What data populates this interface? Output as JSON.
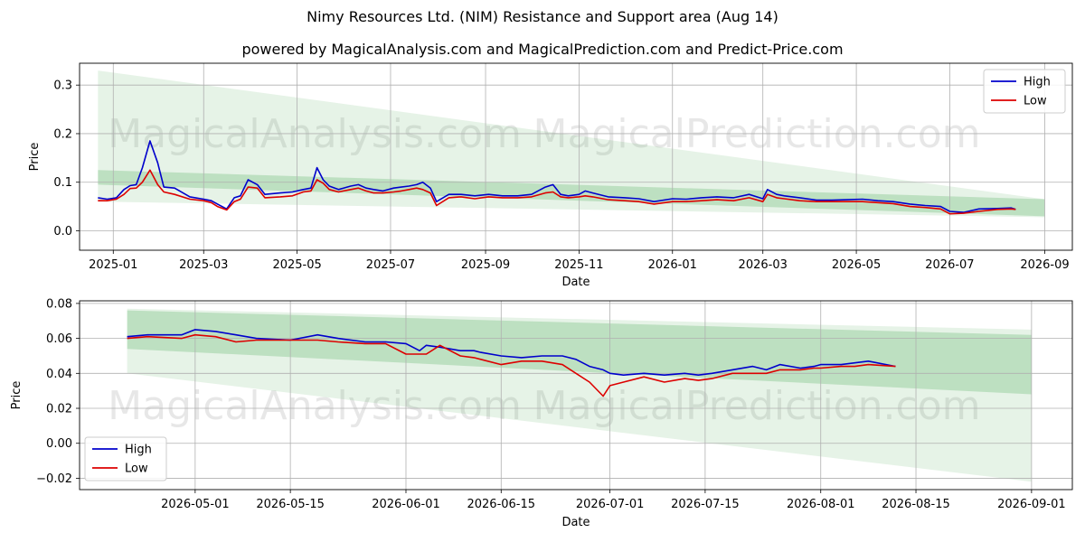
{
  "title": "Nimy Resources Ltd. (NIM) Resistance and Support area (Aug 14)",
  "subtitle": "powered by MagicalAnalysis.com and MagicalPrediction.com and Predict-Price.com",
  "watermarks": [
    "MagicalAnalysis.com",
    "MagicalPrediction.com"
  ],
  "colors": {
    "high": "#0000cc",
    "low": "#dd0000",
    "band": "#2e9e3a"
  },
  "chart_data": [
    {
      "type": "line",
      "xlabel": "Date",
      "ylabel": "Price",
      "xlim": [
        "2024-12-10",
        "2026-09-19"
      ],
      "ylim": [
        -0.04,
        0.345
      ],
      "xticks": [
        {
          "date": "2025-01-01",
          "label": "2025-01"
        },
        {
          "date": "2025-03-01",
          "label": "2025-03"
        },
        {
          "date": "2025-05-01",
          "label": "2025-05"
        },
        {
          "date": "2025-07-01",
          "label": "2025-07"
        },
        {
          "date": "2025-09-01",
          "label": "2025-09"
        },
        {
          "date": "2025-11-01",
          "label": "2025-11"
        },
        {
          "date": "2026-01-01",
          "label": "2026-01"
        },
        {
          "date": "2026-03-01",
          "label": "2026-03"
        },
        {
          "date": "2026-05-01",
          "label": "2026-05"
        },
        {
          "date": "2026-07-01",
          "label": "2026-07"
        },
        {
          "date": "2026-09-01",
          "label": "2026-09"
        }
      ],
      "yticks": [
        0.0,
        0.1,
        0.2,
        0.3
      ],
      "ytick_labels": [
        "0.0",
        "0.1",
        "0.2",
        "0.3"
      ],
      "grid": true,
      "legend": "top-right",
      "bands": [
        {
          "x": [
            "2024-12-22",
            "2026-09-01"
          ],
          "upper": [
            0.33,
            0.065
          ],
          "lower": [
            0.06,
            0.028
          ],
          "alpha": 0.12
        },
        {
          "x": [
            "2024-12-22",
            "2026-09-01"
          ],
          "upper": [
            0.125,
            0.065
          ],
          "lower": [
            0.095,
            0.03
          ],
          "alpha": 0.22
        }
      ],
      "series": [
        {
          "name": "High",
          "x": [
            "2024-12-22",
            "2024-12-28",
            "2025-01-03",
            "2025-01-08",
            "2025-01-12",
            "2025-01-16",
            "2025-01-20",
            "2025-01-25",
            "2025-01-30",
            "2025-02-03",
            "2025-02-10",
            "2025-02-20",
            "2025-03-01",
            "2025-03-06",
            "2025-03-10",
            "2025-03-16",
            "2025-03-21",
            "2025-03-25",
            "2025-03-30",
            "2025-04-05",
            "2025-04-10",
            "2025-04-20",
            "2025-04-28",
            "2025-05-05",
            "2025-05-10",
            "2025-05-14",
            "2025-05-18",
            "2025-05-22",
            "2025-05-28",
            "2025-06-05",
            "2025-06-10",
            "2025-06-15",
            "2025-06-20",
            "2025-06-26",
            "2025-07-03",
            "2025-07-08",
            "2025-07-13",
            "2025-07-18",
            "2025-07-22",
            "2025-07-27",
            "2025-07-31",
            "2025-08-08",
            "2025-08-16",
            "2025-08-25",
            "2025-09-03",
            "2025-09-12",
            "2025-09-22",
            "2025-10-01",
            "2025-10-10",
            "2025-10-15",
            "2025-10-20",
            "2025-10-25",
            "2025-11-01",
            "2025-11-05",
            "2025-11-10",
            "2025-11-20",
            "2025-12-01",
            "2025-12-10",
            "2025-12-20",
            "2026-01-01",
            "2026-01-10",
            "2026-01-20",
            "2026-01-30",
            "2026-02-10",
            "2026-02-20",
            "2026-03-01",
            "2026-03-04",
            "2026-03-10",
            "2026-03-15",
            "2026-03-25",
            "2026-04-05",
            "2026-04-15",
            "2026-04-25",
            "2026-05-05",
            "2026-05-15",
            "2026-05-25",
            "2026-06-05",
            "2026-06-15",
            "2026-06-25",
            "2026-07-01",
            "2026-07-10",
            "2026-07-20",
            "2026-08-01",
            "2026-08-10",
            "2026-08-13"
          ],
          "values": [
            0.068,
            0.065,
            0.068,
            0.085,
            0.093,
            0.095,
            0.13,
            0.185,
            0.14,
            0.09,
            0.088,
            0.07,
            0.065,
            0.062,
            0.055,
            0.045,
            0.068,
            0.072,
            0.105,
            0.095,
            0.075,
            0.078,
            0.08,
            0.085,
            0.088,
            0.13,
            0.105,
            0.092,
            0.085,
            0.092,
            0.095,
            0.088,
            0.085,
            0.082,
            0.088,
            0.09,
            0.092,
            0.095,
            0.1,
            0.088,
            0.06,
            0.075,
            0.075,
            0.072,
            0.075,
            0.072,
            0.072,
            0.075,
            0.09,
            0.095,
            0.075,
            0.072,
            0.075,
            0.082,
            0.078,
            0.07,
            0.068,
            0.066,
            0.06,
            0.066,
            0.065,
            0.068,
            0.07,
            0.068,
            0.075,
            0.066,
            0.085,
            0.075,
            0.072,
            0.068,
            0.063,
            0.063,
            0.064,
            0.065,
            0.062,
            0.06,
            0.055,
            0.052,
            0.05,
            0.04,
            0.038,
            0.045,
            0.046,
            0.047,
            0.044
          ]
        },
        {
          "name": "Low",
          "x": [
            "2024-12-22",
            "2024-12-28",
            "2025-01-03",
            "2025-01-08",
            "2025-01-12",
            "2025-01-16",
            "2025-01-20",
            "2025-01-25",
            "2025-01-30",
            "2025-02-03",
            "2025-02-10",
            "2025-02-20",
            "2025-03-01",
            "2025-03-06",
            "2025-03-10",
            "2025-03-16",
            "2025-03-21",
            "2025-03-25",
            "2025-03-30",
            "2025-04-05",
            "2025-04-10",
            "2025-04-20",
            "2025-04-28",
            "2025-05-05",
            "2025-05-10",
            "2025-05-14",
            "2025-05-18",
            "2025-05-22",
            "2025-05-28",
            "2025-06-05",
            "2025-06-10",
            "2025-06-15",
            "2025-06-20",
            "2025-06-26",
            "2025-07-03",
            "2025-07-08",
            "2025-07-13",
            "2025-07-18",
            "2025-07-22",
            "2025-07-27",
            "2025-07-31",
            "2025-08-08",
            "2025-08-16",
            "2025-08-25",
            "2025-09-03",
            "2025-09-12",
            "2025-09-22",
            "2025-10-01",
            "2025-10-10",
            "2025-10-15",
            "2025-10-20",
            "2025-10-25",
            "2025-11-01",
            "2025-11-05",
            "2025-11-10",
            "2025-11-20",
            "2025-12-01",
            "2025-12-10",
            "2025-12-20",
            "2026-01-01",
            "2026-01-10",
            "2026-01-20",
            "2026-01-30",
            "2026-02-10",
            "2026-02-20",
            "2026-03-01",
            "2026-03-04",
            "2026-03-10",
            "2026-03-15",
            "2026-03-25",
            "2026-04-05",
            "2026-04-15",
            "2026-04-25",
            "2026-05-05",
            "2026-05-15",
            "2026-05-25",
            "2026-06-05",
            "2026-06-15",
            "2026-06-25",
            "2026-07-01",
            "2026-07-10",
            "2026-07-20",
            "2026-08-01",
            "2026-08-10",
            "2026-08-13"
          ],
          "values": [
            0.062,
            0.062,
            0.065,
            0.075,
            0.087,
            0.088,
            0.1,
            0.125,
            0.095,
            0.08,
            0.075,
            0.065,
            0.062,
            0.058,
            0.05,
            0.043,
            0.06,
            0.065,
            0.09,
            0.088,
            0.068,
            0.07,
            0.072,
            0.08,
            0.082,
            0.105,
            0.098,
            0.085,
            0.08,
            0.085,
            0.088,
            0.082,
            0.078,
            0.078,
            0.08,
            0.082,
            0.085,
            0.088,
            0.085,
            0.078,
            0.052,
            0.068,
            0.07,
            0.066,
            0.07,
            0.068,
            0.068,
            0.07,
            0.078,
            0.08,
            0.07,
            0.068,
            0.07,
            0.072,
            0.07,
            0.064,
            0.062,
            0.06,
            0.055,
            0.06,
            0.06,
            0.062,
            0.064,
            0.062,
            0.068,
            0.06,
            0.075,
            0.068,
            0.066,
            0.062,
            0.06,
            0.06,
            0.06,
            0.06,
            0.058,
            0.056,
            0.05,
            0.048,
            0.045,
            0.035,
            0.036,
            0.04,
            0.044,
            0.045,
            0.044
          ]
        }
      ]
    },
    {
      "type": "line",
      "xlabel": "Date",
      "ylabel": "Price",
      "xlim": [
        "2026-04-14",
        "2026-09-07"
      ],
      "ylim": [
        -0.0265,
        0.0815
      ],
      "xticks": [
        {
          "date": "2026-05-01",
          "label": "2026-05-01"
        },
        {
          "date": "2026-05-15",
          "label": "2026-05-15"
        },
        {
          "date": "2026-06-01",
          "label": "2026-06-01"
        },
        {
          "date": "2026-06-15",
          "label": "2026-06-15"
        },
        {
          "date": "2026-07-01",
          "label": "2026-07-01"
        },
        {
          "date": "2026-07-15",
          "label": "2026-07-15"
        },
        {
          "date": "2026-08-01",
          "label": "2026-08-01"
        },
        {
          "date": "2026-08-15",
          "label": "2026-08-15"
        },
        {
          "date": "2026-09-01",
          "label": "2026-09-01"
        }
      ],
      "yticks": [
        -0.02,
        0.0,
        0.02,
        0.04,
        0.06,
        0.08
      ],
      "ytick_labels": [
        "−0.02",
        "0.00",
        "0.02",
        "0.04",
        "0.06",
        "0.08"
      ],
      "grid": true,
      "legend": "bottom-left",
      "bands": [
        {
          "x": [
            "2026-04-21",
            "2026-09-01"
          ],
          "upper": [
            0.077,
            0.065
          ],
          "lower": [
            0.04,
            -0.022
          ],
          "alpha": 0.12
        },
        {
          "x": [
            "2026-04-21",
            "2026-09-01"
          ],
          "upper": [
            0.076,
            0.062
          ],
          "lower": [
            0.054,
            0.028
          ],
          "alpha": 0.22
        }
      ],
      "series": [
        {
          "name": "High",
          "x": [
            "2026-04-21",
            "2026-04-24",
            "2026-04-29",
            "2026-05-01",
            "2026-05-04",
            "2026-05-07",
            "2026-05-10",
            "2026-05-15",
            "2026-05-19",
            "2026-05-22",
            "2026-05-26",
            "2026-05-29",
            "2026-06-01",
            "2026-06-03",
            "2026-06-04",
            "2026-06-06",
            "2026-06-09",
            "2026-06-11",
            "2026-06-12",
            "2026-06-15",
            "2026-06-18",
            "2026-06-21",
            "2026-06-24",
            "2026-06-26",
            "2026-06-28",
            "2026-06-30",
            "2026-07-01",
            "2026-07-03",
            "2026-07-06",
            "2026-07-09",
            "2026-07-12",
            "2026-07-14",
            "2026-07-16",
            "2026-07-19",
            "2026-07-22",
            "2026-07-24",
            "2026-07-26",
            "2026-07-29",
            "2026-07-31",
            "2026-08-01",
            "2026-08-04",
            "2026-08-06",
            "2026-08-08",
            "2026-08-12"
          ],
          "values": [
            0.061,
            0.062,
            0.062,
            0.065,
            0.064,
            0.062,
            0.06,
            0.059,
            0.062,
            0.06,
            0.058,
            0.058,
            0.057,
            0.053,
            0.056,
            0.055,
            0.053,
            0.053,
            0.052,
            0.05,
            0.049,
            0.05,
            0.05,
            0.048,
            0.044,
            0.042,
            0.04,
            0.039,
            0.04,
            0.039,
            0.04,
            0.039,
            0.04,
            0.042,
            0.044,
            0.042,
            0.045,
            0.043,
            0.044,
            0.045,
            0.045,
            0.046,
            0.047,
            0.044
          ]
        },
        {
          "name": "Low",
          "x": [
            "2026-04-21",
            "2026-04-24",
            "2026-04-29",
            "2026-05-01",
            "2026-05-04",
            "2026-05-07",
            "2026-05-10",
            "2026-05-15",
            "2026-05-19",
            "2026-05-22",
            "2026-05-26",
            "2026-05-29",
            "2026-06-01",
            "2026-06-03",
            "2026-06-04",
            "2026-06-06",
            "2026-06-09",
            "2026-06-11",
            "2026-06-12",
            "2026-06-15",
            "2026-06-18",
            "2026-06-21",
            "2026-06-24",
            "2026-06-26",
            "2026-06-28",
            "2026-06-30",
            "2026-07-01",
            "2026-07-03",
            "2026-07-06",
            "2026-07-09",
            "2026-07-12",
            "2026-07-14",
            "2026-07-16",
            "2026-07-19",
            "2026-07-22",
            "2026-07-24",
            "2026-07-26",
            "2026-07-29",
            "2026-07-31",
            "2026-08-01",
            "2026-08-04",
            "2026-08-06",
            "2026-08-08",
            "2026-08-12"
          ],
          "values": [
            0.06,
            0.061,
            0.06,
            0.062,
            0.061,
            0.058,
            0.059,
            0.059,
            0.059,
            0.058,
            0.057,
            0.057,
            0.051,
            0.051,
            0.051,
            0.056,
            0.05,
            0.049,
            0.048,
            0.045,
            0.047,
            0.047,
            0.045,
            0.04,
            0.035,
            0.027,
            0.033,
            0.035,
            0.038,
            0.035,
            0.037,
            0.036,
            0.037,
            0.04,
            0.04,
            0.04,
            0.042,
            0.042,
            0.043,
            0.043,
            0.044,
            0.044,
            0.045,
            0.044
          ]
        }
      ]
    }
  ]
}
